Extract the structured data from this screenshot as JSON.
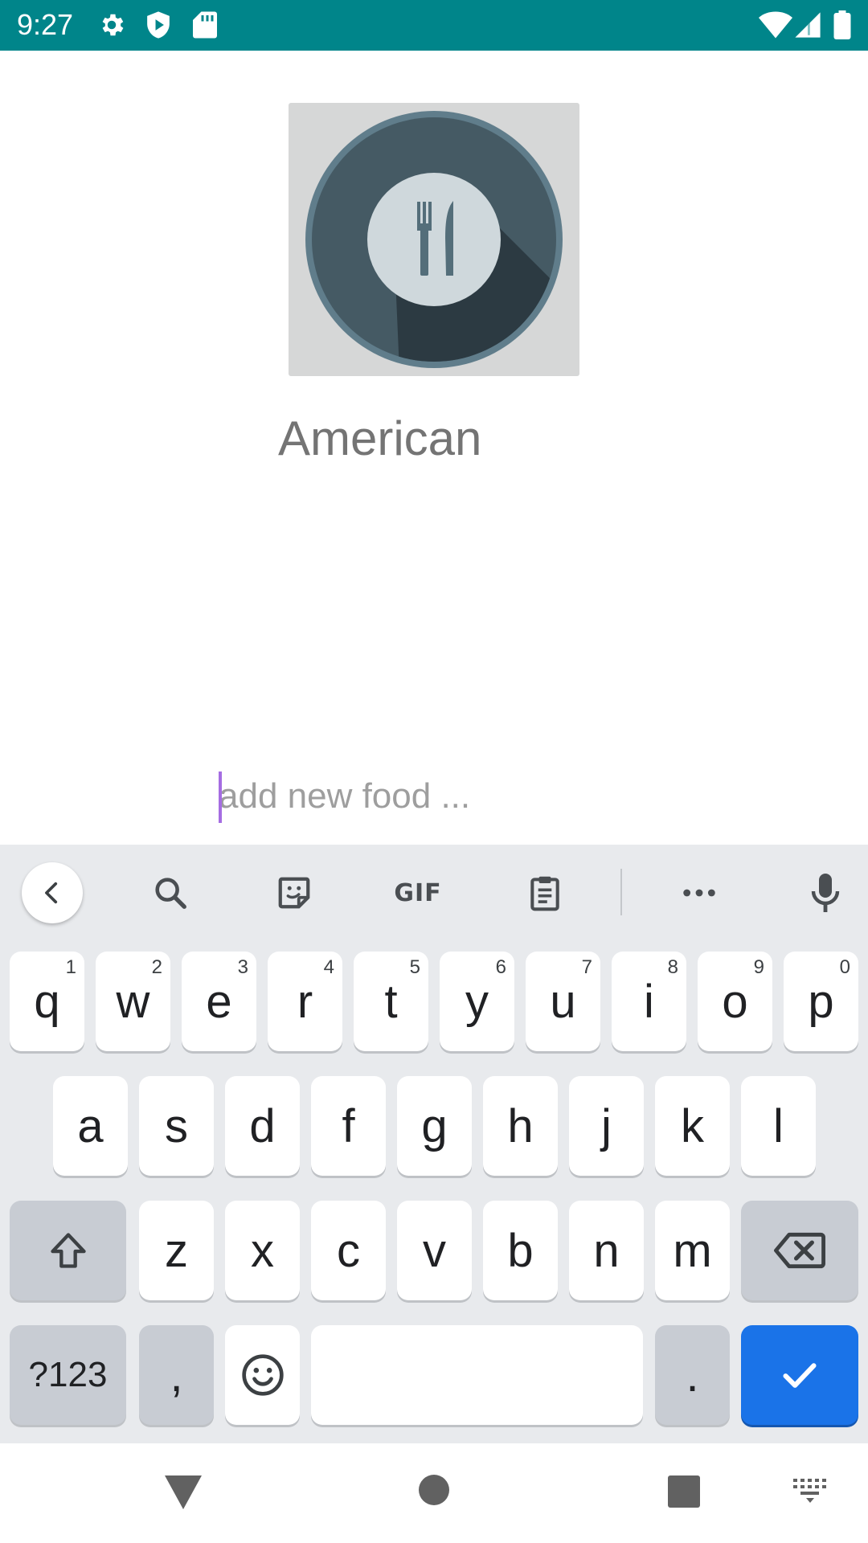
{
  "status_bar": {
    "time": "9:27",
    "icons": [
      "settings-icon",
      "play-protect-icon",
      "sd-card-icon",
      "wifi-icon",
      "signal-icon",
      "battery-icon"
    ],
    "background": "#00858a"
  },
  "cuisine": {
    "name": "American",
    "image_icon": "restaurant-plate-icon"
  },
  "food_input": {
    "placeholder": "add new food ...",
    "value": ""
  },
  "keyboard": {
    "toolbar": [
      "back-arrow-icon",
      "search-icon",
      "sticker-icon",
      "GIF",
      "clipboard-icon",
      "more-icon",
      "mic-icon"
    ],
    "gif_label": "GIF",
    "row1": [
      {
        "label": "q",
        "hint": "1"
      },
      {
        "label": "w",
        "hint": "2"
      },
      {
        "label": "e",
        "hint": "3"
      },
      {
        "label": "r",
        "hint": "4"
      },
      {
        "label": "t",
        "hint": "5"
      },
      {
        "label": "y",
        "hint": "6"
      },
      {
        "label": "u",
        "hint": "7"
      },
      {
        "label": "i",
        "hint": "8"
      },
      {
        "label": "o",
        "hint": "9"
      },
      {
        "label": "p",
        "hint": "0"
      }
    ],
    "row2": [
      {
        "label": "a"
      },
      {
        "label": "s"
      },
      {
        "label": "d"
      },
      {
        "label": "f"
      },
      {
        "label": "g"
      },
      {
        "label": "h"
      },
      {
        "label": "j"
      },
      {
        "label": "k"
      },
      {
        "label": "l"
      }
    ],
    "row3": [
      {
        "label": "z"
      },
      {
        "label": "x"
      },
      {
        "label": "c"
      },
      {
        "label": "v"
      },
      {
        "label": "b"
      },
      {
        "label": "n"
      },
      {
        "label": "m"
      }
    ],
    "symbols_label": "?123",
    "comma_label": ",",
    "period_label": ".",
    "accent_color": "#1a73e8"
  },
  "nav_bar": {
    "buttons": [
      "back-icon",
      "home-icon",
      "recents-icon",
      "keyboard-switch-icon"
    ]
  }
}
